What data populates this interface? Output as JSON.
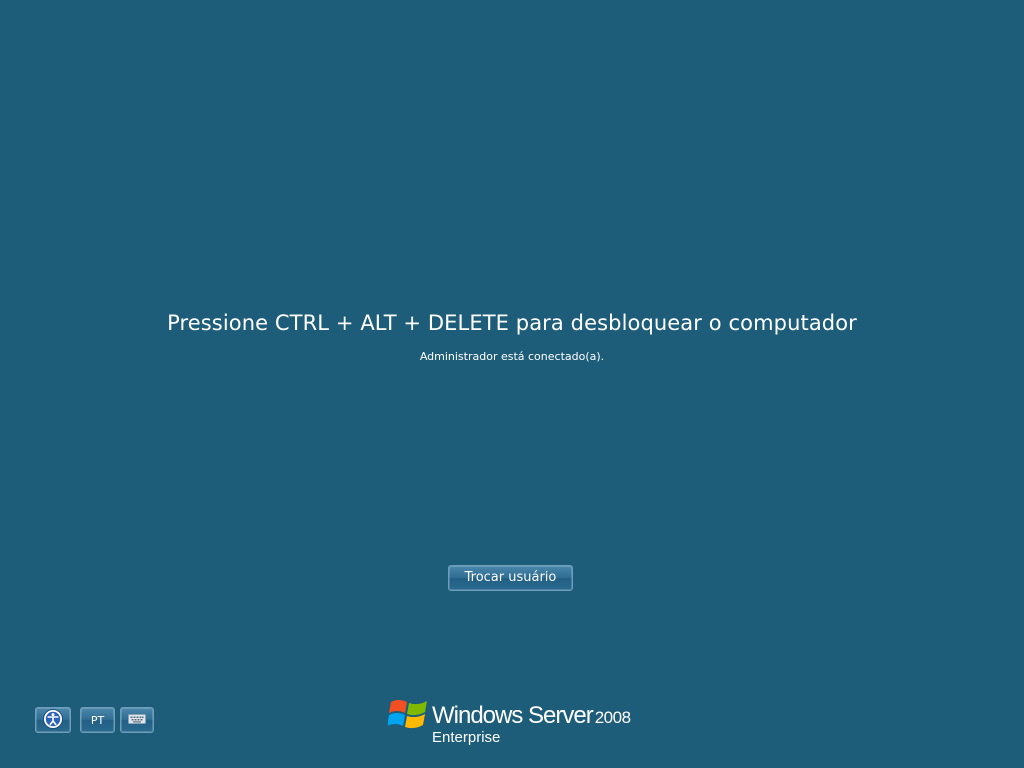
{
  "lock_screen": {
    "message": "Pressione CTRL + ALT + DELETE para desbloquear o computador",
    "status": "Administrador está conectado(a)."
  },
  "buttons": {
    "switch_user": "Trocar usuário",
    "language": "PT",
    "ease_of_access_icon": "ease-of-access-icon",
    "keyboard_icon": "keyboard-icon"
  },
  "branding": {
    "product": "Windows Server",
    "version": "2008",
    "edition": "Enterprise",
    "logo_icon": "windows-flag-logo"
  },
  "colors": {
    "background": "#1e5d7a",
    "button_top": "#4a87ab",
    "button_bottom": "#225f84",
    "text": "#ffffff"
  }
}
